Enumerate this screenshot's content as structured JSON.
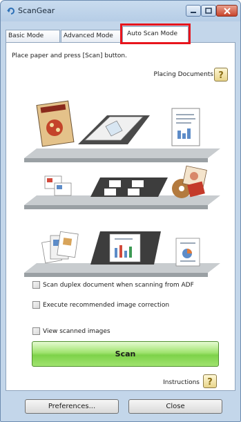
{
  "window": {
    "title": "ScanGear"
  },
  "tabs": [
    {
      "label": "Basic Mode"
    },
    {
      "label": "Advanced Mode"
    },
    {
      "label": "Auto Scan Mode",
      "active": true
    }
  ],
  "panel": {
    "hint": "Place paper and press [Scan] button.",
    "placing_documents_label": "Placing Documents",
    "checkboxes": [
      {
        "label": "Scan duplex document when scanning from ADF",
        "checked": false
      },
      {
        "label": "Execute recommended image correction",
        "checked": false
      },
      {
        "label": "View scanned images",
        "checked": false
      }
    ],
    "scan_label": "Scan",
    "instructions_label": "Instructions"
  },
  "footer": {
    "preferences_label": "Preferences...",
    "close_label": "Close"
  },
  "colors": {
    "highlight": "#e8141c",
    "scan_button": "#8ad95a",
    "help_icon": "#e8d48a"
  }
}
